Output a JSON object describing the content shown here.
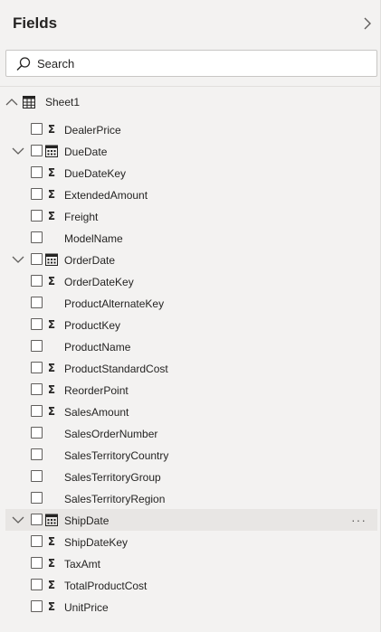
{
  "pane": {
    "title": "Fields"
  },
  "search": {
    "placeholder": "Search"
  },
  "table": {
    "name": "Sheet1",
    "fields": [
      {
        "name": "DealerPrice",
        "type": "sigma"
      },
      {
        "name": "DueDate",
        "type": "calendar",
        "expandable": true
      },
      {
        "name": "DueDateKey",
        "type": "sigma"
      },
      {
        "name": "ExtendedAmount",
        "type": "sigma"
      },
      {
        "name": "Freight",
        "type": "sigma"
      },
      {
        "name": "ModelName",
        "type": "text"
      },
      {
        "name": "OrderDate",
        "type": "calendar",
        "expandable": true
      },
      {
        "name": "OrderDateKey",
        "type": "sigma"
      },
      {
        "name": "ProductAlternateKey",
        "type": "text"
      },
      {
        "name": "ProductKey",
        "type": "sigma"
      },
      {
        "name": "ProductName",
        "type": "text"
      },
      {
        "name": "ProductStandardCost",
        "type": "sigma"
      },
      {
        "name": "ReorderPoint",
        "type": "sigma"
      },
      {
        "name": "SalesAmount",
        "type": "sigma"
      },
      {
        "name": "SalesOrderNumber",
        "type": "text"
      },
      {
        "name": "SalesTerritoryCountry",
        "type": "text"
      },
      {
        "name": "SalesTerritoryGroup",
        "type": "text"
      },
      {
        "name": "SalesTerritoryRegion",
        "type": "text"
      },
      {
        "name": "ShipDate",
        "type": "calendar",
        "expandable": true,
        "hovered": true
      },
      {
        "name": "ShipDateKey",
        "type": "sigma"
      },
      {
        "name": "TaxAmt",
        "type": "sigma"
      },
      {
        "name": "TotalProductCost",
        "type": "sigma"
      },
      {
        "name": "UnitPrice",
        "type": "sigma"
      }
    ]
  },
  "more_options": "···",
  "colors": {
    "background": "#f3f2f1",
    "hover_row": "#e8e6e4",
    "text": "#252423",
    "border": "#c8c6c4"
  },
  "icons": {
    "collapse_pane": "chevron-right-icon",
    "search": "search-icon",
    "table": "table-icon",
    "numeric": "sigma-icon",
    "date": "calendar-icon",
    "expand": "chevron-down-icon",
    "collapse": "chevron-up-icon"
  }
}
